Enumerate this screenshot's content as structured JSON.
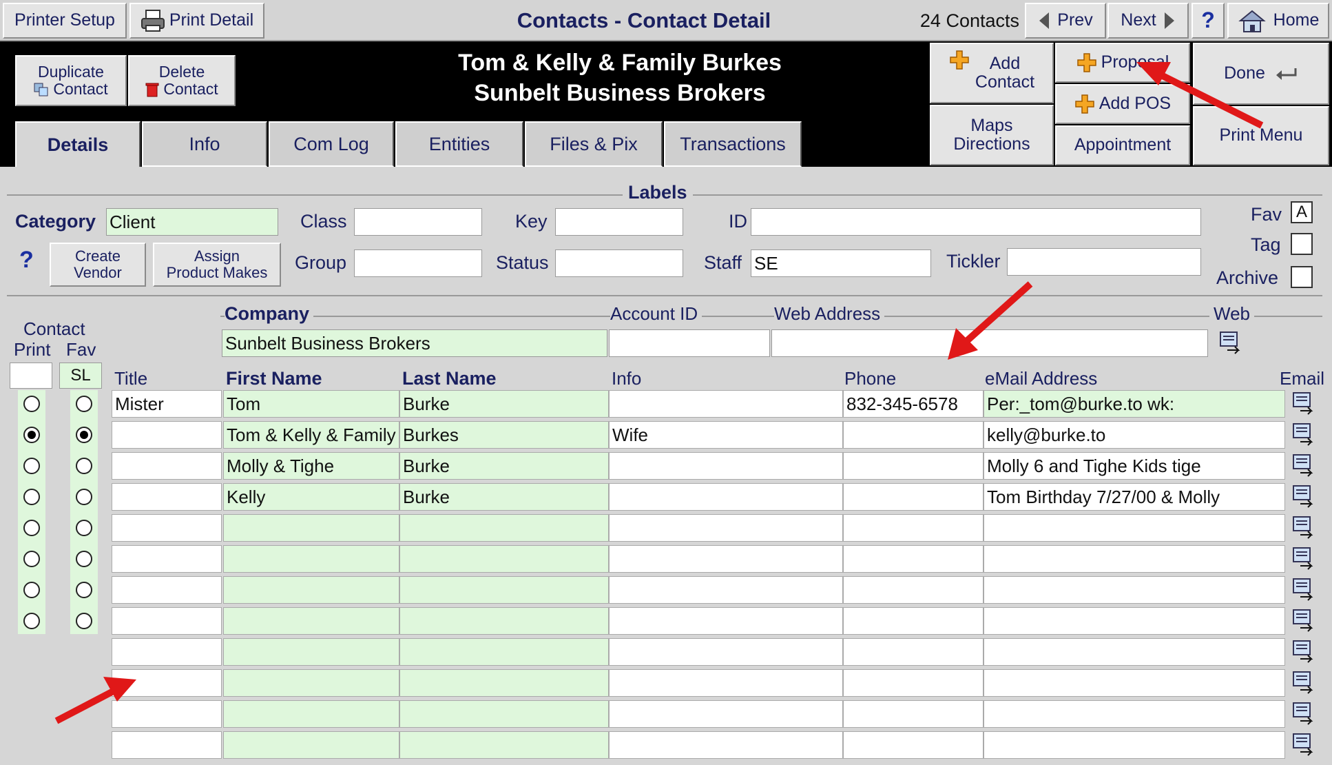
{
  "topbar": {
    "printer_setup": "Printer Setup",
    "print_detail": "Print Detail",
    "title": "Contacts - Contact Detail",
    "count": "24 Contacts",
    "prev": "Prev",
    "next": "Next",
    "help": "?",
    "home": "Home"
  },
  "header": {
    "line1": "Tom & Kelly & Family Burkes",
    "line2": "Sunbelt Business Brokers",
    "duplicate": [
      "Duplicate",
      "Contact"
    ],
    "delete": [
      "Delete",
      "Contact"
    ],
    "add_contact": [
      "Add",
      "Contact"
    ],
    "proposal": "Proposal",
    "add_pos": "Add POS",
    "maps": [
      "Maps",
      "Directions"
    ],
    "appointment": "Appointment",
    "done": "Done",
    "print_menu": "Print Menu"
  },
  "tabs": [
    "Details",
    "Info",
    "Com Log",
    "Entities",
    "Files & Pix",
    "Transactions"
  ],
  "labels_section": {
    "title": "Labels",
    "category_label": "Category",
    "category_value": "Client",
    "class_label": "Class",
    "key_label": "Key",
    "id_label": "ID",
    "group_label": "Group",
    "status_label": "Status",
    "staff_label": "Staff",
    "staff_value": "SE",
    "tickler_label": "Tickler",
    "fav_label": "Fav",
    "fav_value": "A",
    "tag_label": "Tag",
    "archive_label": "Archive",
    "help": "?",
    "create_vendor": [
      "Create",
      "Vendor"
    ],
    "assign_makes": [
      "Assign",
      "Product Makes"
    ]
  },
  "company_section": {
    "contact_label": "Contact",
    "print_label": "Print",
    "fav_label": "Fav",
    "sl_value": "SL",
    "company_label": "Company",
    "company_value": "Sunbelt Business Brokers",
    "account_label": "Account ID",
    "web_address_label": "Web Address",
    "web_label": "Web"
  },
  "table": {
    "headers": {
      "title": "Title",
      "first": "First Name",
      "last": "Last Name",
      "info": "Info",
      "phone": "Phone",
      "email": "eMail Address",
      "email_btn": "Email"
    },
    "rows": [
      {
        "title": "Mister",
        "first": "Tom",
        "last": "Burke",
        "info": "",
        "phone": "832-345-6578",
        "email": "Per:_tom@burke.to      wk:",
        "print": false,
        "fav": false
      },
      {
        "title": "",
        "first": "Tom & Kelly & Family",
        "last": "Burkes",
        "info": "Wife",
        "phone": "",
        "email": "kelly@burke.to",
        "print": true,
        "fav": true
      },
      {
        "title": "",
        "first": "Molly & Tighe",
        "last": "Burke",
        "info": "",
        "phone": "",
        "email": "Molly 6 and Tighe   Kids  tige",
        "print": false,
        "fav": false
      },
      {
        "title": "",
        "first": "Kelly",
        "last": "Burke",
        "info": "",
        "phone": "",
        "email": "Tom Birthday 7/27/00 & Molly",
        "print": false,
        "fav": false
      },
      {
        "title": "",
        "first": "",
        "last": "",
        "info": "",
        "phone": "",
        "email": "",
        "print": false,
        "fav": false
      },
      {
        "title": "",
        "first": "",
        "last": "",
        "info": "",
        "phone": "",
        "email": "",
        "print": false,
        "fav": false
      },
      {
        "title": "",
        "first": "",
        "last": "",
        "info": "",
        "phone": "",
        "email": "",
        "print": false,
        "fav": false
      },
      {
        "title": "",
        "first": "",
        "last": "",
        "info": "",
        "phone": "",
        "email": "",
        "print": false,
        "fav": false
      },
      {
        "title": "",
        "first": "",
        "last": "",
        "info": "",
        "phone": "",
        "email": ""
      },
      {
        "title": "",
        "first": "",
        "last": "",
        "info": "",
        "phone": "",
        "email": ""
      },
      {
        "title": "",
        "first": "",
        "last": "",
        "info": "",
        "phone": "",
        "email": ""
      },
      {
        "title": "",
        "first": "",
        "last": "",
        "info": "",
        "phone": "",
        "email": ""
      }
    ]
  },
  "colors": {
    "highlight": "#dff7dc",
    "header_black": "#000000",
    "arrow_red": "#e01818"
  }
}
